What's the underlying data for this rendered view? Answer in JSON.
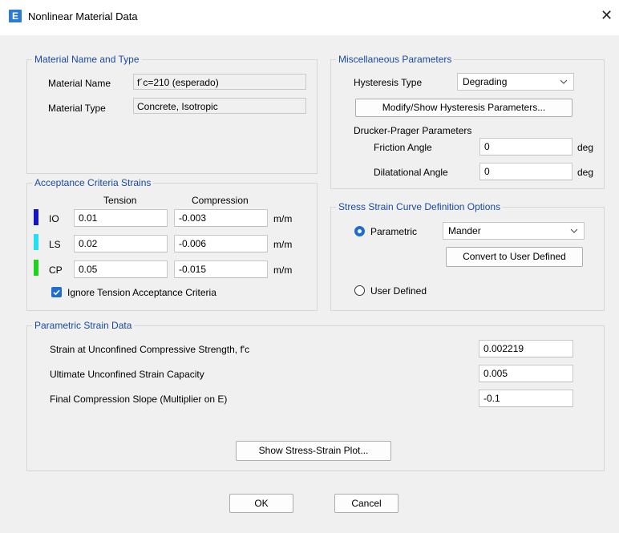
{
  "window": {
    "title": "Nonlinear Material Data",
    "app_icon_letter": "E"
  },
  "material_group": {
    "title": "Material Name and Type",
    "name_label": "Material Name",
    "name_value": "f´c=210 (esperado)",
    "type_label": "Material Type",
    "type_value": "Concrete, Isotropic"
  },
  "misc_group": {
    "title": "Miscellaneous Parameters",
    "hysteresis_label": "Hysteresis Type",
    "hysteresis_value": "Degrading",
    "modify_button": "Modify/Show Hysteresis Parameters...",
    "drucker_label": "Drucker-Prager Parameters",
    "friction_label": "Friction Angle",
    "friction_value": "0",
    "friction_unit": "deg",
    "dilatational_label": "Dilatational Angle",
    "dilatational_value": "0",
    "dilatational_unit": "deg"
  },
  "acceptance_group": {
    "title": "Acceptance Criteria Strains",
    "tension_header": "Tension",
    "compression_header": "Compression",
    "rows": [
      {
        "label": "IO",
        "color": "#1515c8",
        "tension": "0.01",
        "compression": "-0.003",
        "unit": "m/m"
      },
      {
        "label": "LS",
        "color": "#22e0f0",
        "tension": "0.02",
        "compression": "-0.006",
        "unit": "m/m"
      },
      {
        "label": "CP",
        "color": "#1ed21e",
        "tension": "0.05",
        "compression": "-0.015",
        "unit": "m/m"
      }
    ],
    "ignore_label": "Ignore Tension Acceptance Criteria",
    "ignore_checked": true
  },
  "stress_group": {
    "title": "Stress Strain Curve Definition Options",
    "parametric_label": "Parametric",
    "parametric_selected": true,
    "parametric_value": "Mander",
    "convert_button": "Convert to User Defined",
    "user_defined_label": "User Defined"
  },
  "strain_group": {
    "title": "Parametric Strain Data",
    "rows": [
      {
        "label": "Strain at Unconfined Compressive Strength, f'c",
        "value": "0.002219"
      },
      {
        "label": "Ultimate Unconfined Strain Capacity",
        "value": "0.005"
      },
      {
        "label": "Final Compression Slope (Multiplier on E)",
        "value": "-0.1"
      }
    ],
    "plot_button": "Show Stress-Strain Plot..."
  },
  "footer": {
    "ok_button": "OK",
    "cancel_button": "Cancel"
  },
  "colors": {
    "accent": "#1a4aa1",
    "checkbox": "#1f6ecf"
  }
}
